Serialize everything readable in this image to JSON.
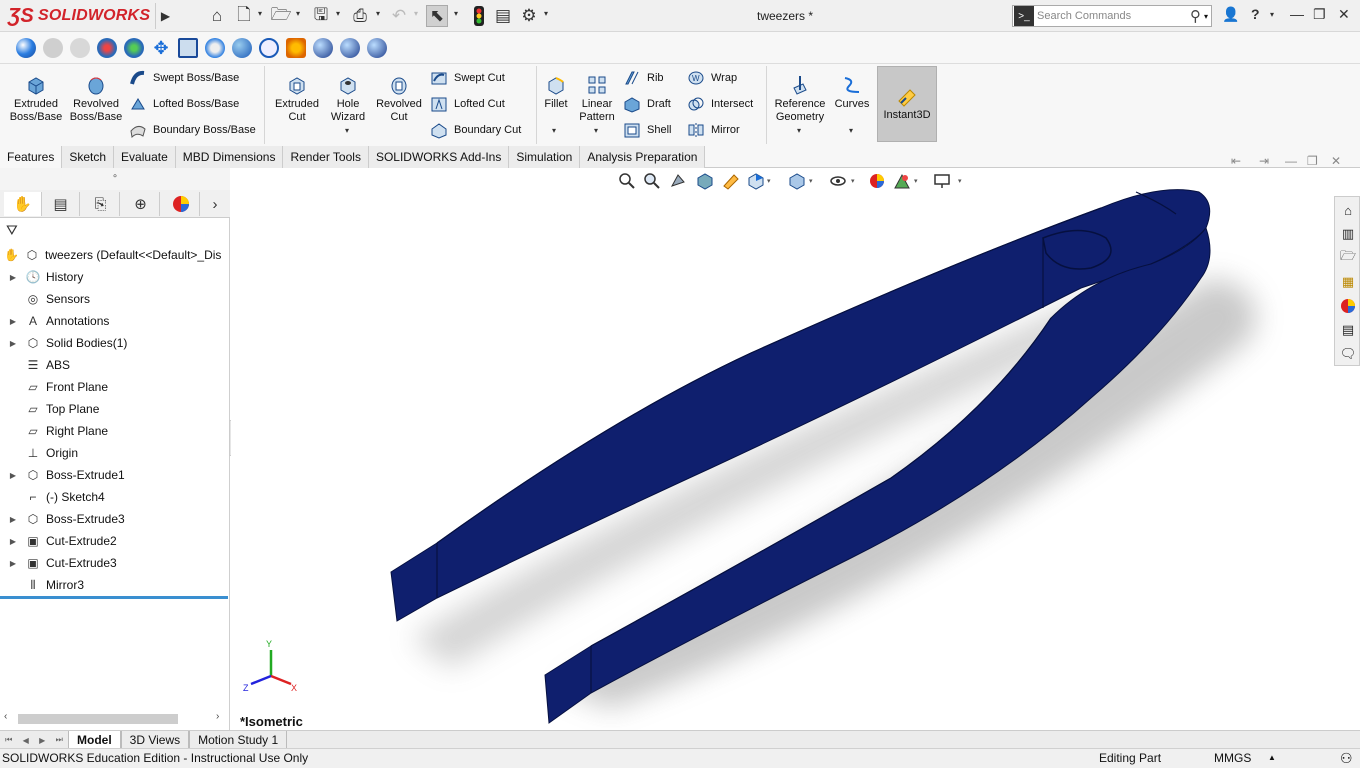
{
  "app": {
    "brand": "SOLIDWORKS",
    "document_title": "tweezers *",
    "search_placeholder": "Search Commands",
    "help_label": "?"
  },
  "ribbon": {
    "extruded_boss": "Extruded Boss/Base",
    "revolved_boss": "Revolved Boss/Base",
    "swept_boss": "Swept Boss/Base",
    "lofted_boss": "Lofted Boss/Base",
    "boundary_boss": "Boundary Boss/Base",
    "extruded_cut": "Extruded Cut",
    "hole_wizard": "Hole Wizard",
    "revolved_cut": "Revolved Cut",
    "swept_cut": "Swept Cut",
    "lofted_cut": "Lofted Cut",
    "boundary_cut": "Boundary Cut",
    "fillet": "Fillet",
    "linear_pattern": "Linear Pattern",
    "rib": "Rib",
    "draft": "Draft",
    "shell": "Shell",
    "wrap": "Wrap",
    "intersect": "Intersect",
    "mirror": "Mirror",
    "reference_geometry": "Reference Geometry",
    "curves": "Curves",
    "instant3d": "Instant3D"
  },
  "tabs": [
    "Features",
    "Sketch",
    "Evaluate",
    "MBD Dimensions",
    "Render Tools",
    "SOLIDWORKS Add-Ins",
    "Simulation",
    "Analysis Preparation"
  ],
  "tree": {
    "root": "tweezers  (Default<<Default>_Dis",
    "items": [
      {
        "label": "History",
        "expandable": true
      },
      {
        "label": "Sensors",
        "expandable": false
      },
      {
        "label": "Annotations",
        "expandable": true
      },
      {
        "label": "Solid Bodies(1)",
        "expandable": true
      },
      {
        "label": "ABS",
        "expandable": false
      },
      {
        "label": "Front Plane",
        "expandable": false
      },
      {
        "label": "Top Plane",
        "expandable": false
      },
      {
        "label": "Right Plane",
        "expandable": false
      },
      {
        "label": "Origin",
        "expandable": false
      },
      {
        "label": "Boss-Extrude1",
        "expandable": true
      },
      {
        "label": "(-) Sketch4",
        "expandable": false
      },
      {
        "label": "Boss-Extrude3",
        "expandable": true
      },
      {
        "label": "Cut-Extrude2",
        "expandable": true
      },
      {
        "label": "Cut-Extrude3",
        "expandable": true
      },
      {
        "label": "Mirror3",
        "expandable": false
      }
    ]
  },
  "viewport": {
    "view_name": "*Isometric",
    "triad": {
      "x": "X",
      "y": "Y",
      "z": "Z"
    },
    "model_color": "#0f1f6e"
  },
  "model_tabs": [
    "Model",
    "3D Views",
    "Motion Study 1"
  ],
  "status": {
    "left": "SOLIDWORKS Education Edition - Instructional Use Only",
    "editing": "Editing Part",
    "units": "MMGS"
  }
}
